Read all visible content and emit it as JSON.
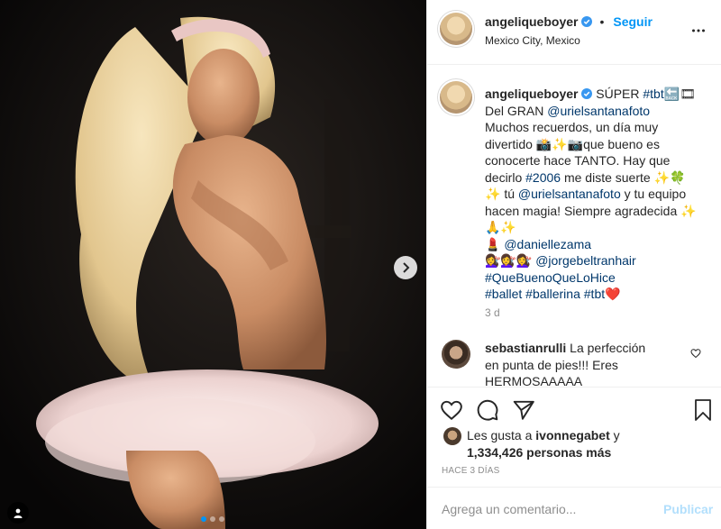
{
  "post": {
    "author": "angeliqueboyer",
    "follow_label": "Seguir",
    "bullet": "•",
    "location": "Mexico City, Mexico"
  },
  "caption": {
    "author": "angeliqueboyer",
    "l1_a": " SÚPER ",
    "l1_tag": "#tbt",
    "l1_b": "🔙🎞",
    "l2_a": "Del GRAN ",
    "l2_tag": "@urielsantanafoto",
    "l3": "Muchos recuerdos, un día muy",
    "l4": "divertido 📸✨📷que bueno es",
    "l5": "conocerte hace TANTO. Hay que",
    "l6_a": "decirlo ",
    "l6_tag": "#2006",
    "l6_b": " me diste suerte ✨🍀",
    "l7_a": "✨ tú ",
    "l7_tag": "@urielsantanafoto",
    "l7_b": " y tu equipo",
    "l8": "hacen magia! Siempre agradecida ✨",
    "l9": "🙏✨",
    "l10_a": "💄 ",
    "l10_tag": "@daniellezama",
    "l11_a": "💇‍♀️💇‍♀️💇‍♀️ ",
    "l11_tag": "@jorgebeltranhair",
    "l12_tag": "#QueBuenoQueLoHice",
    "l13_tag1": "#ballet",
    "l13_tag2": "#ballerina",
    "l13_tag3": "#tbt",
    "l13_heart": "❤️",
    "time": "3 d"
  },
  "comment": {
    "author": "sebastianrulli",
    "l1": " La perfección",
    "l2": "en punta de pies!!! Eres",
    "l3": "HERMOSAAAAA SIEMPREEEEE"
  },
  "likes": {
    "prefix": "Les gusta a ",
    "user": "ivonnegabet",
    "mid": " y",
    "count": "1,334,426 personas más"
  },
  "date_label": "HACE 3 DÍAS",
  "comment_input": {
    "placeholder": "Agrega un comentario..."
  },
  "publish_label": "Publicar",
  "carousel": {
    "count": 3,
    "active": 1
  },
  "colors": {
    "accent": "#0095f6",
    "verified": "#3897f0",
    "heart": "#ed4956",
    "link": "#00376b"
  }
}
